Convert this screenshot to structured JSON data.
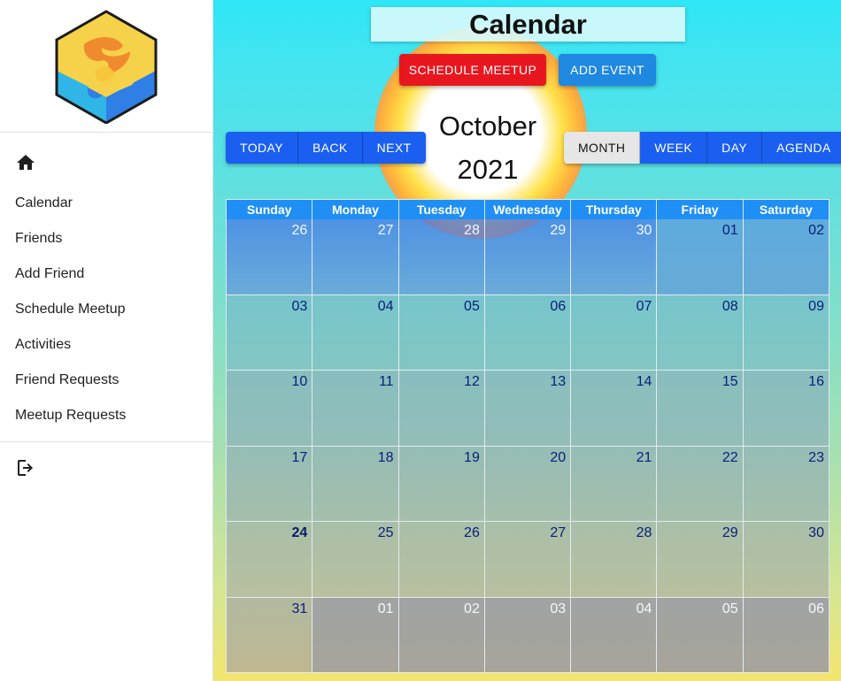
{
  "sidebar": {
    "items": [
      {
        "label": "Calendar"
      },
      {
        "label": "Friends"
      },
      {
        "label": "Add Friend"
      },
      {
        "label": "Schedule Meetup"
      },
      {
        "label": "Activities"
      },
      {
        "label": "Friend Requests"
      },
      {
        "label": "Meetup Requests"
      }
    ]
  },
  "header": {
    "title": "Calendar",
    "schedule_label": "SCHEDULE MEETUP",
    "add_event_label": "ADD EVENT"
  },
  "toolbar": {
    "today_label": "TODAY",
    "back_label": "BACK",
    "next_label": "NEXT",
    "month": "October",
    "year": "2021",
    "views": [
      {
        "label": "MONTH",
        "active": true
      },
      {
        "label": "WEEK",
        "active": false
      },
      {
        "label": "DAY",
        "active": false
      },
      {
        "label": "AGENDA",
        "active": false
      }
    ]
  },
  "calendar": {
    "weekdays": [
      "Sunday",
      "Monday",
      "Tuesday",
      "Wednesday",
      "Thursday",
      "Friday",
      "Saturday"
    ],
    "weeks": [
      [
        "26",
        "27",
        "28",
        "29",
        "30",
        "01",
        "02"
      ],
      [
        "03",
        "04",
        "05",
        "06",
        "07",
        "08",
        "09"
      ],
      [
        "10",
        "11",
        "12",
        "13",
        "14",
        "15",
        "16"
      ],
      [
        "17",
        "18",
        "19",
        "20",
        "21",
        "22",
        "23"
      ],
      [
        "24",
        "25",
        "26",
        "27",
        "28",
        "29",
        "30"
      ],
      [
        "31",
        "01",
        "02",
        "03",
        "04",
        "05",
        "06"
      ]
    ],
    "today": "24"
  },
  "colors": {
    "accent_blue": "#1a5ff0",
    "accent_red": "#e8171f",
    "add_event_blue": "#1f88e0",
    "header_blue": "#1f8ff5",
    "date_text": "#0a1d7a"
  },
  "icons": {
    "logo": "puzzle-hexagon-logo",
    "home": "home-icon",
    "logout": "logout-icon"
  }
}
